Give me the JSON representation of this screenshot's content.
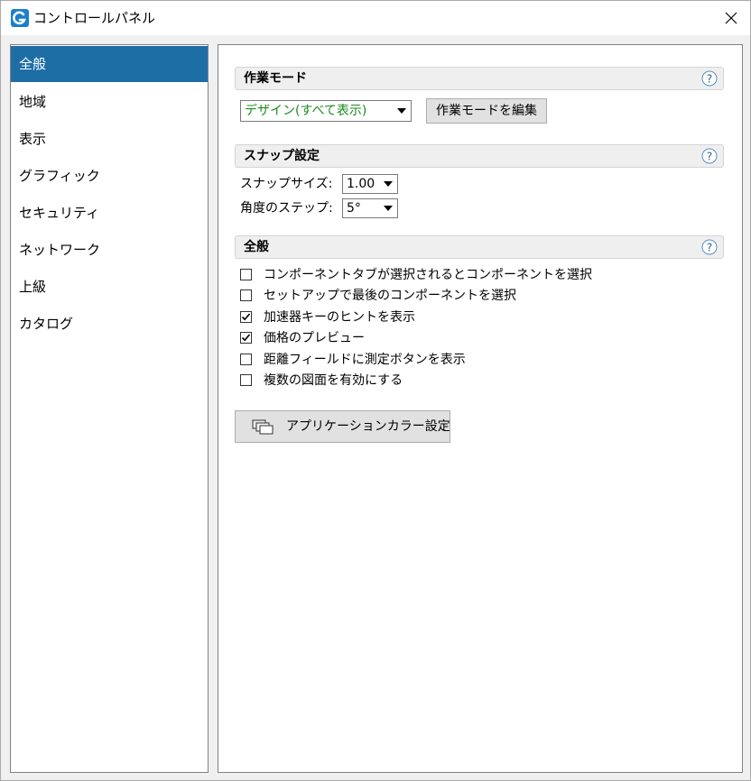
{
  "window": {
    "title": "コントロールパネル",
    "accent_color": "#1e6ea6"
  },
  "sidebar": {
    "items": [
      {
        "label": "全般",
        "active": true
      },
      {
        "label": "地域",
        "active": false
      },
      {
        "label": "表示",
        "active": false
      },
      {
        "label": "グラフィック",
        "active": false
      },
      {
        "label": "セキュリティ",
        "active": false
      },
      {
        "label": "ネットワーク",
        "active": false
      },
      {
        "label": "上級",
        "active": false
      },
      {
        "label": "カタログ",
        "active": false
      }
    ]
  },
  "sections": {
    "work_mode": {
      "title": "作業モード",
      "help": "?",
      "selected_mode": "デザイン(すべて表示)",
      "edit_button": "作業モードを編集"
    },
    "snap": {
      "title": "スナップ設定",
      "help": "?",
      "snap_size_label": "スナップサイズ:",
      "snap_size_value": "1.00",
      "angle_step_label": "角度のステップ:",
      "angle_step_value": "5°"
    },
    "general": {
      "title": "全般",
      "help": "?",
      "options": [
        {
          "label": "コンポーネントタブが選択されるとコンポーネントを選択",
          "checked": false
        },
        {
          "label": "セットアップで最後のコンポーネントを選択",
          "checked": false
        },
        {
          "label": "加速器キーのヒントを表示",
          "checked": true
        },
        {
          "label": "価格のプレビュー",
          "checked": true
        },
        {
          "label": "距離フィールドに測定ボタンを表示",
          "checked": false
        },
        {
          "label": "複数の図面を有効にする",
          "checked": false
        }
      ],
      "color_button": "アプリケーションカラー設定"
    }
  }
}
